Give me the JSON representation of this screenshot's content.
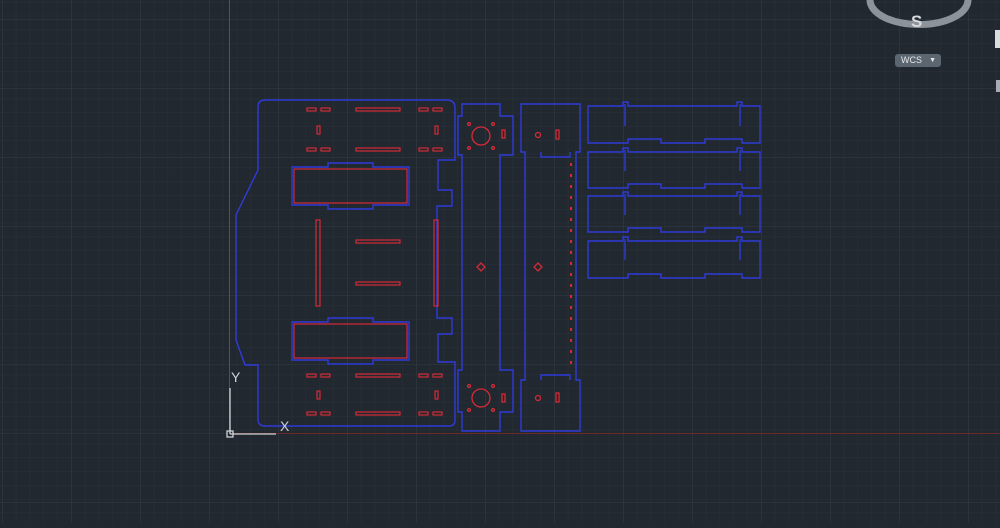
{
  "viewcube": {
    "compass_direction": "S",
    "coordinate_system": "WCS",
    "coordinate_system_icon": "chevron-down-icon"
  },
  "ucs_icon": {
    "x_label": "X",
    "y_label": "Y"
  },
  "colors": {
    "background": "#212830",
    "grid_minor": "#2a323c",
    "grid_major": "#333d48",
    "outline_layer": "#2f3bd8",
    "cut_layer": "#d52a35",
    "x_axis": "#7a2a2a",
    "y_axis": "#2e6b3a"
  }
}
